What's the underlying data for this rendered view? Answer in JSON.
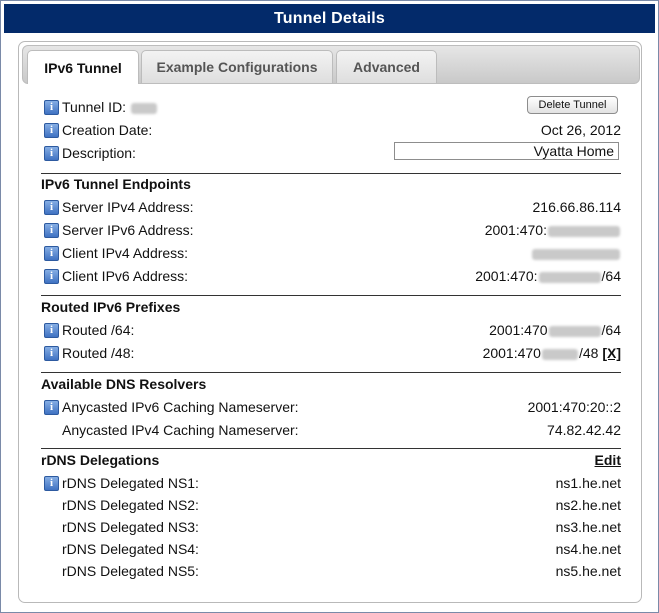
{
  "window": {
    "title": "Tunnel Details"
  },
  "tabs": [
    {
      "label": "IPv6 Tunnel",
      "active": true
    },
    {
      "label": "Example Configurations",
      "active": false
    },
    {
      "label": "Advanced",
      "active": false
    }
  ],
  "general": {
    "tunnel_id_label": "Tunnel ID:",
    "delete_button": "Delete Tunnel",
    "creation_date_label": "Creation Date:",
    "creation_date": "Oct 26, 2012",
    "description_label": "Description:",
    "description_value": "Vyatta Home"
  },
  "endpoints": {
    "heading": "IPv6 Tunnel Endpoints",
    "server_ipv4_label": "Server IPv4 Address:",
    "server_ipv4": "216.66.86.114",
    "server_ipv6_label": "Server IPv6 Address:",
    "server_ipv6_prefix": "2001:470:",
    "client_ipv4_label": "Client IPv4 Address:",
    "client_ipv6_label": "Client IPv6 Address:",
    "client_ipv6_prefix": "2001:470:",
    "client_ipv6_suffix": "/64"
  },
  "routed": {
    "heading": "Routed IPv6 Prefixes",
    "r64_label": "Routed /64:",
    "r64_prefix": "2001:470",
    "r64_suffix": "/64",
    "r48_label": "Routed /48:",
    "r48_prefix": "2001:470",
    "r48_suffix": "/48",
    "r48_remove": "[X]"
  },
  "dns": {
    "heading": "Available DNS Resolvers",
    "v6_label": "Anycasted IPv6 Caching Nameserver:",
    "v6_value": "2001:470:20::2",
    "v4_label": "Anycasted IPv4 Caching Nameserver:",
    "v4_value": "74.82.42.42"
  },
  "rdns": {
    "heading": "rDNS Delegations",
    "edit_link": "Edit",
    "items": [
      {
        "label": "rDNS Delegated NS1:",
        "value": "ns1.he.net"
      },
      {
        "label": "rDNS Delegated NS2:",
        "value": "ns2.he.net"
      },
      {
        "label": "rDNS Delegated NS3:",
        "value": "ns3.he.net"
      },
      {
        "label": "rDNS Delegated NS4:",
        "value": "ns4.he.net"
      },
      {
        "label": "rDNS Delegated NS5:",
        "value": "ns5.he.net"
      }
    ]
  },
  "colors": {
    "titlebar": "#032a6a",
    "info_icon": "#3f72c2"
  }
}
